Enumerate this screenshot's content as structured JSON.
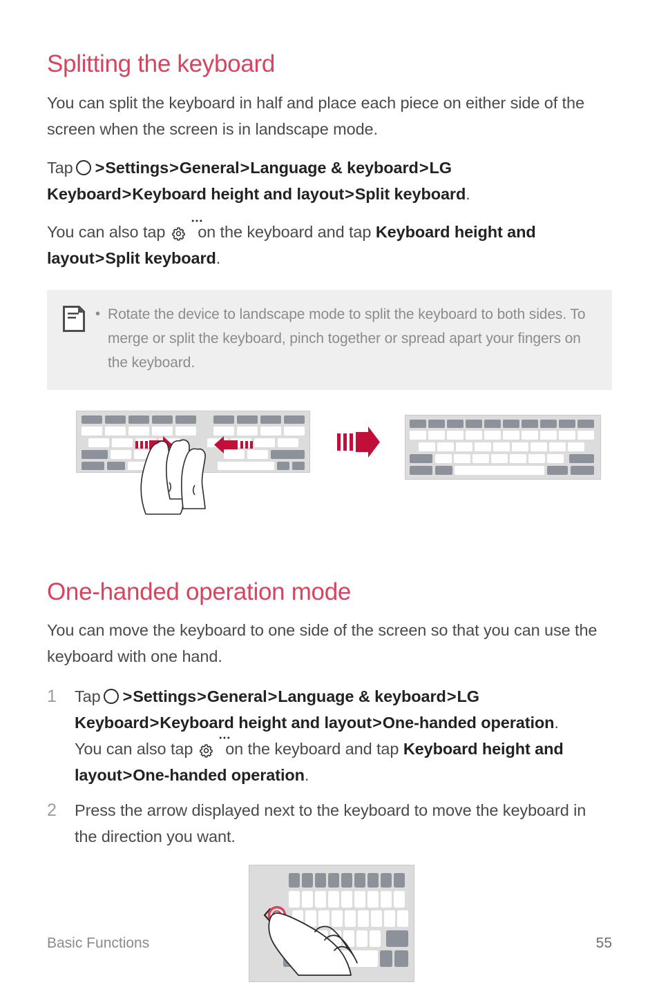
{
  "sections": [
    {
      "id": "splitting-the-keyboard",
      "title": "Splitting the keyboard",
      "intro": "You can split the keyboard in half and place each piece on either side of the screen when the screen is in landscape mode.",
      "path_line": {
        "prefix": "Tap",
        "home_icon": "home-circle-icon",
        "steps": [
          "Settings",
          "General",
          "Language & keyboard",
          "LG Keyboard",
          "Keyboard height and layout",
          "Split keyboard"
        ],
        "separator": ">",
        "terminator": "."
      },
      "alt_line": {
        "before_icon": "You can also tap",
        "gear_icon": "gear-more-icon",
        "after_icon": "on the keyboard and tap",
        "steps": [
          "Keyboard height and layout",
          "Split keyboard"
        ],
        "separator": ">",
        "terminator": "."
      },
      "note": {
        "icon": "note-document-icon",
        "bullet": "•",
        "text": "Rotate the device to landscape mode to split the keyboard to both sides. To merge or split the keyboard, pinch together or spread apart your fingers on the keyboard."
      },
      "figure": {
        "name": "split-keyboard-figure",
        "left_label": "split-keyboard-with-pinch-gesture",
        "arrow_label": "transform-arrow-icon",
        "right_label": "merged-full-keyboard"
      }
    },
    {
      "id": "one-handed-operation-mode",
      "title": "One-handed operation mode",
      "intro": "You can move the keyboard to one side of the screen so that you can use the keyboard with one hand.",
      "steps": [
        {
          "number": "1",
          "path_line": {
            "prefix": "Tap",
            "home_icon": "home-circle-icon",
            "steps": [
              "Settings",
              "General",
              "Language & keyboard",
              "LG Keyboard",
              "Keyboard height and layout",
              "One-handed operation"
            ],
            "separator": ">",
            "terminator": "."
          },
          "alt_line": {
            "before_icon": "You can also tap",
            "gear_icon": "gear-more-icon",
            "after_icon": "on the keyboard and tap",
            "steps": [
              "Keyboard height and layout",
              "One-handed operation"
            ],
            "separator": ">",
            "terminator": "."
          }
        },
        {
          "number": "2",
          "text": "Press the arrow displayed next to the keyboard to move the keyboard in the direction you want."
        }
      ],
      "figure": {
        "name": "one-handed-keyboard-figure",
        "label": "right-aligned-keyboard-with-move-arrow-and-hand",
        "arrow_label": "move-left-chevron-icon"
      }
    }
  ],
  "footer": {
    "chapter": "Basic Functions",
    "page_number": "55"
  },
  "colors": {
    "heading": "#D6445E",
    "accent_arrow": "#C0103A",
    "note_background": "#efefef",
    "keyboard_panel": "#dcdcdc",
    "key_dark": "#8d919a",
    "key_light": "#ffffff",
    "body_text": "#4a4a4a",
    "muted_text": "#8b8b8b"
  }
}
